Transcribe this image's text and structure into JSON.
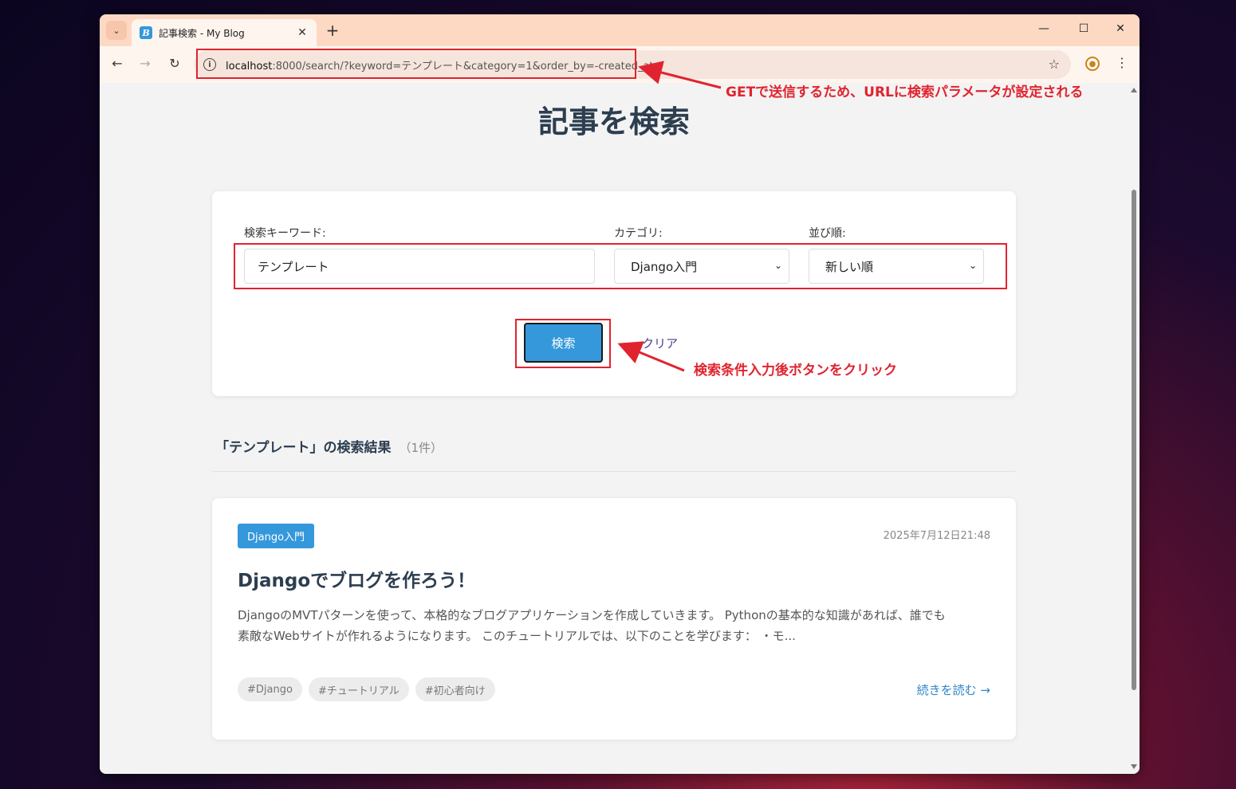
{
  "browser": {
    "tab_title": "記事検索 - My Blog",
    "favicon_letter": "B",
    "url_host": "localhost",
    "url_rest": ":8000/search/?keyword=テンプレート&category=1&order_by=-created_at"
  },
  "page": {
    "title": "記事を検索",
    "form": {
      "keyword_label": "検索キーワード:",
      "keyword_value": "テンプレート",
      "category_label": "カテゴリ:",
      "category_value": "Django入門",
      "order_label": "並び順:",
      "order_value": "新しい順",
      "search_button": "検索",
      "clear_link": "クリア"
    },
    "results": {
      "heading": "「テンプレート」の検索結果",
      "count": "（1件）"
    },
    "article": {
      "category": "Django入門",
      "date": "2025年7月12日21:48",
      "title": "Djangoでブログを作ろう！",
      "excerpt_line1": "DjangoのMVTパターンを使って、本格的なブログアプリケーションを作成していきます。 Pythonの基本的な知識があれば、誰でも",
      "excerpt_line2": "素敵なWebサイトが作れるようになります。 このチュートリアルでは、以下のことを学びます： ・モ...",
      "tags": [
        "#Django",
        "#チュートリアル",
        "#初心者向け"
      ],
      "read_more": "続きを読む →"
    }
  },
  "annotations": {
    "url_note": "GETで送信するため、URLに検索パラメータが設定される",
    "button_note": "検索条件入力後ボタンをクリック"
  },
  "colors": {
    "accent": "#3498db",
    "annotation_red": "#e0242f",
    "heading": "#2c3e50"
  }
}
